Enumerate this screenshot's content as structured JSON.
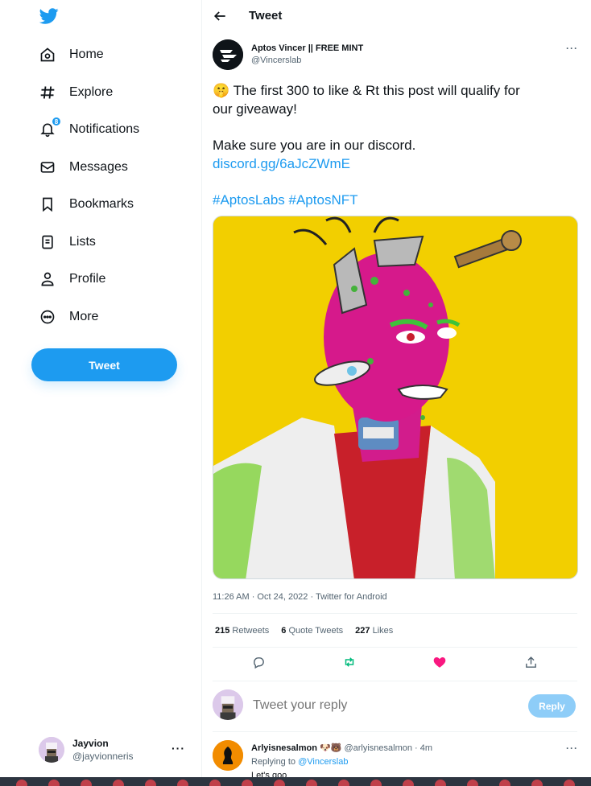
{
  "sidebar": {
    "logo": "twitter-bird-icon",
    "items": [
      {
        "label": "Home",
        "icon": "home-icon"
      },
      {
        "label": "Explore",
        "icon": "hashtag-icon"
      },
      {
        "label": "Notifications",
        "icon": "bell-icon",
        "badge": "8"
      },
      {
        "label": "Messages",
        "icon": "envelope-icon"
      },
      {
        "label": "Bookmarks",
        "icon": "bookmark-icon"
      },
      {
        "label": "Lists",
        "icon": "list-icon"
      },
      {
        "label": "Profile",
        "icon": "person-icon"
      },
      {
        "label": "More",
        "icon": "more-circle-icon"
      }
    ],
    "tweet_button": "Tweet",
    "account": {
      "name": "Jayvion",
      "handle": "@jayvionneris",
      "more": "···"
    }
  },
  "header": {
    "title": "Tweet"
  },
  "tweet": {
    "author_name": "Aptos Vincer || FREE MINT",
    "author_handle": "@Vincerslab",
    "more": "···",
    "line1": "🤫 The first 300 to like & Rt this post will qualify for",
    "line2": "our giveaway!",
    "line3": "Make sure you are in our discord.",
    "link": "discord.gg/6aJcZWmE",
    "hashtags": "#AptosLabs #AptosNFT",
    "meta": "11:26 AM · Oct 24, 2022 · Twitter for Android",
    "stats": {
      "retweets_count": "215",
      "retweets_label": "Retweets",
      "quotes_count": "6",
      "quotes_label": "Quote Tweets",
      "likes_count": "227",
      "likes_label": "Likes"
    }
  },
  "reply_box": {
    "placeholder": "Tweet your reply",
    "button": "Reply"
  },
  "reply": {
    "name": "Arlyisnesalmon 🐶🐻",
    "handle_time": "@arlyisnesalmon · 4m",
    "replying_prefix": "Replying to",
    "replying_to": "@Vincerslab",
    "text": "Let's goo",
    "more": "···"
  },
  "colors": {
    "accent": "#1d9bf0",
    "like": "#f91880",
    "retweet": "#00ba7c",
    "media_bg": "#f2cf00"
  }
}
